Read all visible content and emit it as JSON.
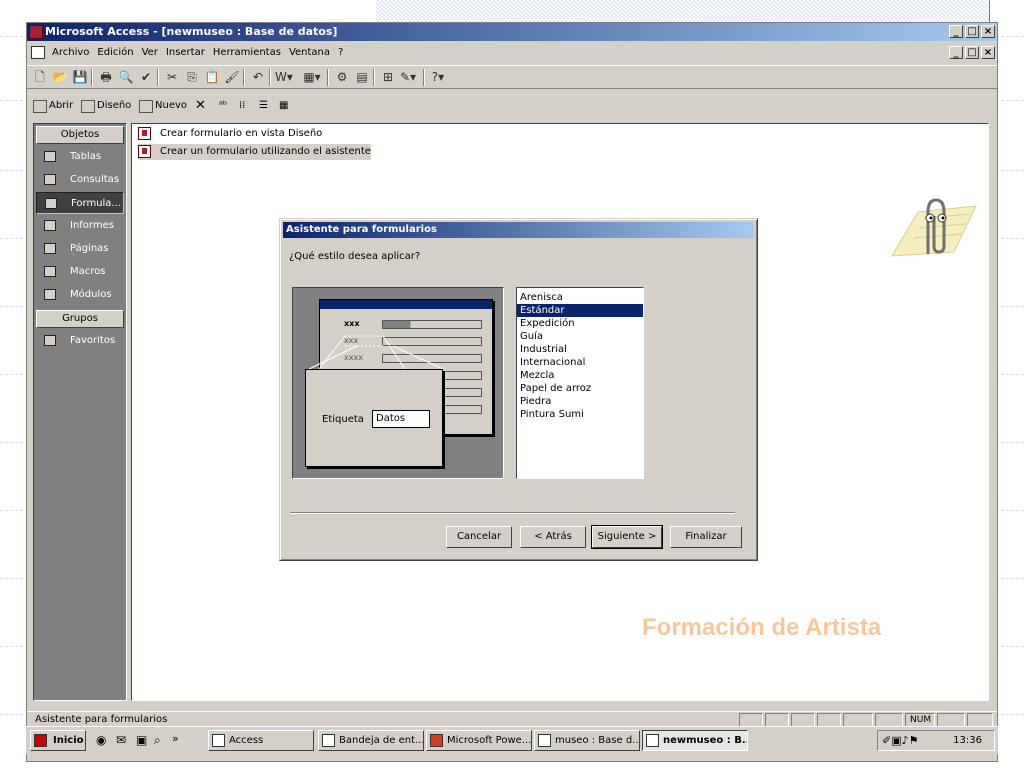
{
  "window": {
    "title": "Microsoft Access - [newmuseo : Base de datos]",
    "controls": [
      "_",
      "□",
      "×"
    ]
  },
  "menu": [
    "Archivo",
    "Edición",
    "Ver",
    "Insertar",
    "Herramientas",
    "Ventana",
    "?"
  ],
  "db_toolbar": {
    "open": "Abrir",
    "design": "Diseño",
    "new": "Nuevo"
  },
  "objects": {
    "header": "Objetos",
    "items": [
      "Tablas",
      "Consultas",
      "Formula...",
      "Informes",
      "Páginas",
      "Macros",
      "Módulos"
    ],
    "selected_index": 2,
    "groups_header": "Grupos",
    "favorites": "Favoritos"
  },
  "list": [
    "Crear formulario en vista Diseño",
    "Crear un formulario utilizando el asistente"
  ],
  "wizard": {
    "title": "Asistente para formularios",
    "question": "¿Qué estilo desea aplicar?",
    "preview": {
      "rows": [
        "xxx",
        "xxx",
        "xxxx",
        "",
        "",
        ""
      ],
      "label": "Etiqueta",
      "field": "Datos"
    },
    "styles": [
      "Arenisca",
      "Estándar",
      "Expedición",
      "Guía",
      "Industrial",
      "Internacional",
      "Mezcla",
      "Papel de arroz",
      "Piedra",
      "Pintura Sumi"
    ],
    "selected_style": "Estándar",
    "buttons": {
      "cancel": "Cancelar",
      "back": "< Atrás",
      "next": "Siguiente >",
      "finish": "Finalizar"
    }
  },
  "statusbar": {
    "text": "Asistente para formularios",
    "num": "NUM"
  },
  "taskbar": {
    "start": "Inicio",
    "tasks": [
      "Access",
      "Bandeja de ent...",
      "Microsoft Powe...",
      "museo : Base d...",
      "newmuseo : B..."
    ],
    "active_task": "newmuseo : B...",
    "clock": "13:36"
  },
  "slide_brand": "Formación de Artista",
  "colors": {
    "titlebar_start": "#0a246a",
    "titlebar_end": "#a6caf0",
    "face": "#d4d0c8",
    "brand": "#f7c79c"
  }
}
